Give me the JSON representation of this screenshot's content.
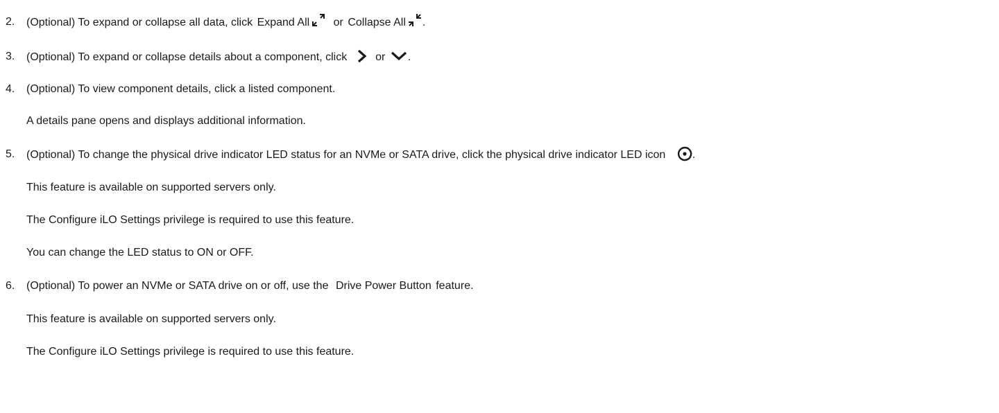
{
  "steps": [
    {
      "number": "2.",
      "before": "(Optional) To expand or collapse all data, click",
      "term1": "Expand All",
      "mid": "or",
      "term2": "Collapse All",
      "after": "."
    },
    {
      "number": "3.",
      "before": "(Optional) To expand or collapse details about a component, click",
      "mid": "or",
      "after": "."
    },
    {
      "number": "4.",
      "text": "(Optional) To view component details, click a listed component.",
      "subs": [
        "A details pane opens and displays additional information."
      ]
    },
    {
      "number": "5.",
      "text": "(Optional) To change the physical drive indicator LED status for an NVMe or SATA drive, click the physical drive indicator LED icon",
      "after": ".",
      "subs": [
        "This feature is available on supported servers only.",
        "The Configure iLO Settings privilege is required to use this feature.",
        "You can change the LED status to ON or OFF."
      ]
    },
    {
      "number": "6.",
      "before": "(Optional) To power an NVMe or SATA drive on or off, use the",
      "term": "Drive Power Button",
      "after": "feature.",
      "subs": [
        "This feature is available on supported servers only.",
        "The Configure iLO Settings privilege is required to use this feature."
      ]
    }
  ]
}
